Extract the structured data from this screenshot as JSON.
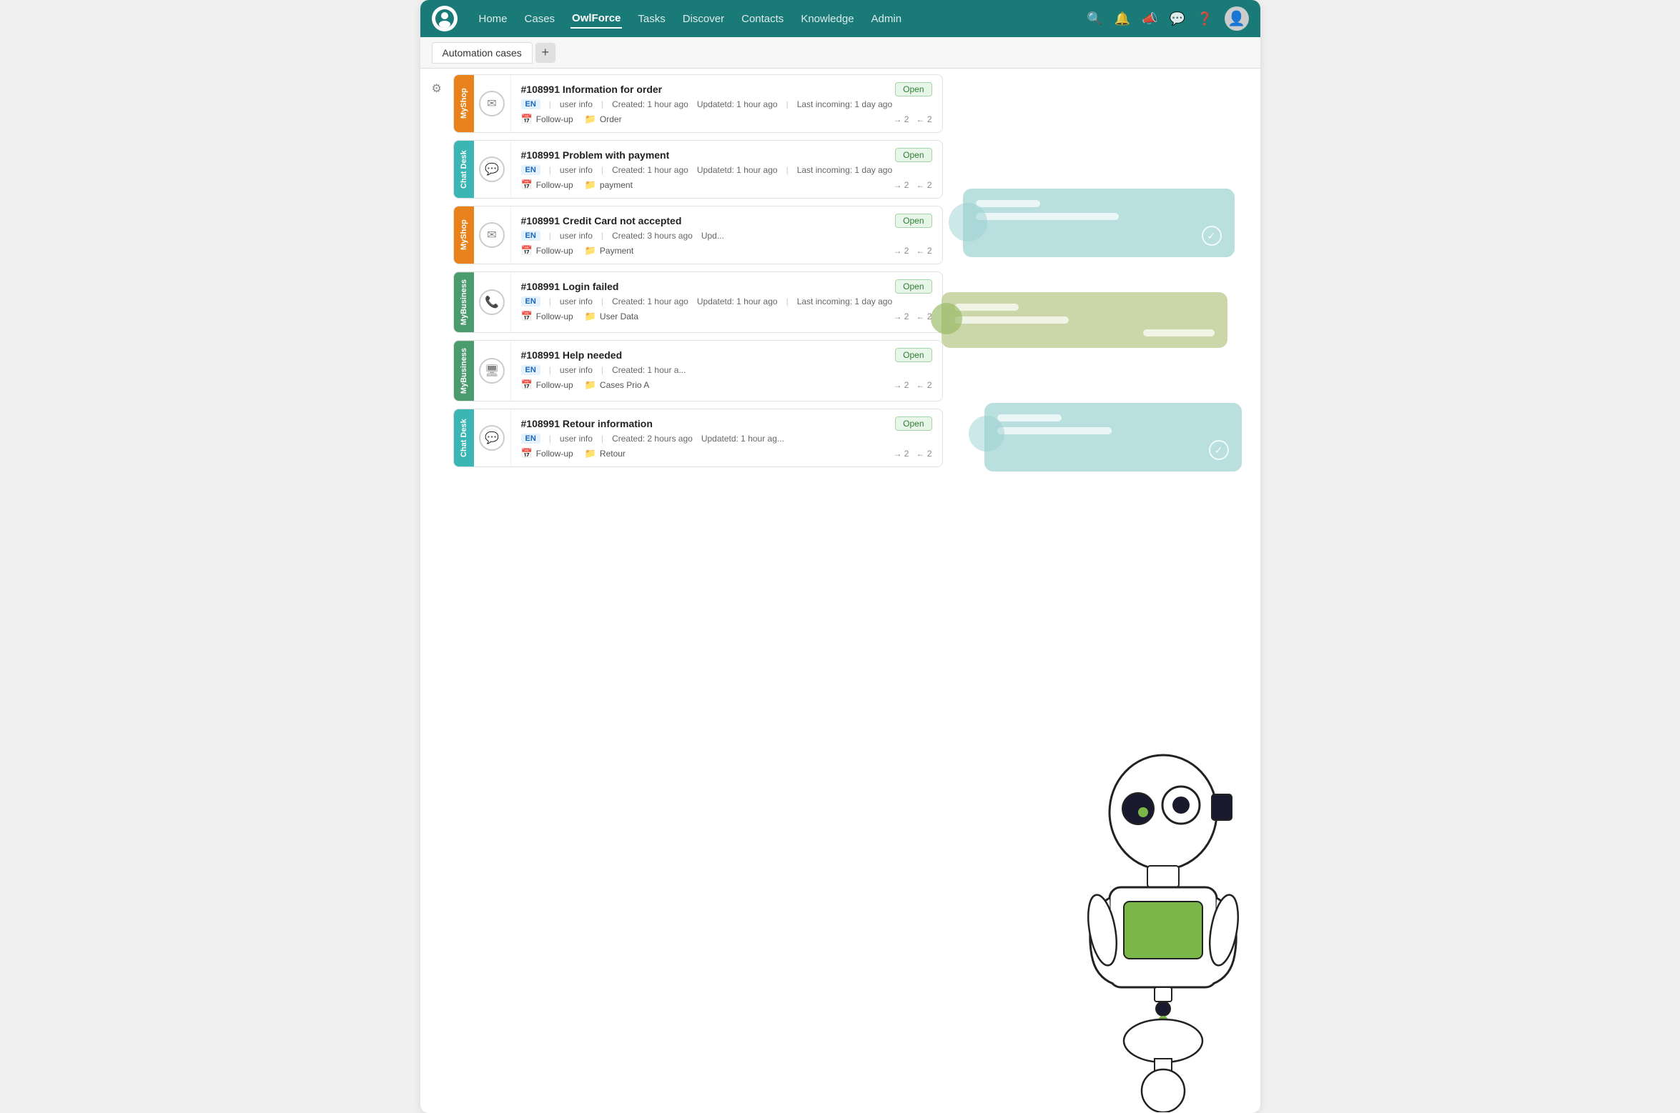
{
  "nav": {
    "items": [
      {
        "label": "Home",
        "active": false
      },
      {
        "label": "Cases",
        "active": false
      },
      {
        "label": "OwlForce",
        "active": true
      },
      {
        "label": "Tasks",
        "active": false
      },
      {
        "label": "Discover",
        "active": false
      },
      {
        "label": "Contacts",
        "active": false
      },
      {
        "label": "Knowledge",
        "active": false
      },
      {
        "label": "Admin",
        "active": false
      }
    ]
  },
  "tabs": {
    "items": [
      {
        "label": "Automation cases"
      }
    ],
    "add_label": "+"
  },
  "cases": [
    {
      "id": "#108991",
      "title": "Information for order",
      "channel_tag": "MyShop",
      "tag_class": "tag-myshop",
      "icon": "✉",
      "lang": "EN",
      "meta": "user info",
      "created": "Created: 1 hour ago",
      "updated": "Updatetd: 1 hour ago",
      "last_incoming": "Last incoming: 1 day ago",
      "status": "Open",
      "follow_up": "Follow-up",
      "folder": "Order",
      "arrows_out": "→ 2",
      "arrows_in": "← 2"
    },
    {
      "id": "#108991",
      "title": "Problem with payment",
      "channel_tag": "Chat Desk",
      "tag_class": "tag-chatdesk",
      "icon": "💬",
      "lang": "EN",
      "meta": "user info",
      "created": "Created: 1 hour ago",
      "updated": "Updatetd: 1 hour ago",
      "last_incoming": "Last incoming: 1 day ago",
      "status": "Open",
      "follow_up": "Follow-up",
      "folder": "payment",
      "arrows_out": "→ 2",
      "arrows_in": "← 2"
    },
    {
      "id": "#108991",
      "title": "Credit Card not accepted",
      "channel_tag": "MyShop",
      "tag_class": "tag-myshop",
      "icon": "✉",
      "lang": "EN",
      "meta": "user info",
      "created": "Created: 3 hours ago",
      "updated": "Upd...",
      "last_incoming": "",
      "status": "Open",
      "follow_up": "Follow-up",
      "folder": "Payment",
      "arrows_out": "→ 2",
      "arrows_in": "← 2"
    },
    {
      "id": "#108991",
      "title": "Login failed",
      "channel_tag": "MyBusiness",
      "tag_class": "tag-mybusiness",
      "icon": "📞",
      "lang": "EN",
      "meta": "user info",
      "created": "Created: 1 hour ago",
      "updated": "Updatetd: 1 hour ago",
      "last_incoming": "Last incoming: 1 day ago",
      "status": "Open",
      "follow_up": "Follow-up",
      "folder": "User Data",
      "arrows_out": "→ 2",
      "arrows_in": "← 2"
    },
    {
      "id": "#108991",
      "title": "Help needed",
      "channel_tag": "MyBusiness",
      "tag_class": "tag-mybusiness",
      "icon": "🖥",
      "lang": "EN",
      "meta": "user info",
      "created": "Created: 1 hour a...",
      "updated": "",
      "last_incoming": "",
      "status": "Open",
      "follow_up": "Follow-up",
      "folder": "Cases Prio A",
      "arrows_out": "→ 2",
      "arrows_in": "← 2"
    },
    {
      "id": "#108991",
      "title": "Retour information",
      "channel_tag": "Chat Desk",
      "tag_class": "tag-chatdesk",
      "icon": "💬",
      "lang": "EN",
      "meta": "user info",
      "created": "Created: 2 hours ago",
      "updated": "Updatetd: 1 hour ag...",
      "last_incoming": "",
      "status": "Open",
      "follow_up": "Follow-up",
      "folder": "Retour",
      "arrows_out": "→ 2",
      "arrows_in": "← 2"
    }
  ],
  "bubbles": {
    "teal1": {
      "top": "285",
      "left": "340",
      "width": "420",
      "height": "130"
    },
    "teal2": {
      "top": "617",
      "left": "415",
      "width": "390",
      "height": "120"
    },
    "olive": {
      "top": "450",
      "left": "285",
      "width": "460",
      "height": "130"
    }
  }
}
